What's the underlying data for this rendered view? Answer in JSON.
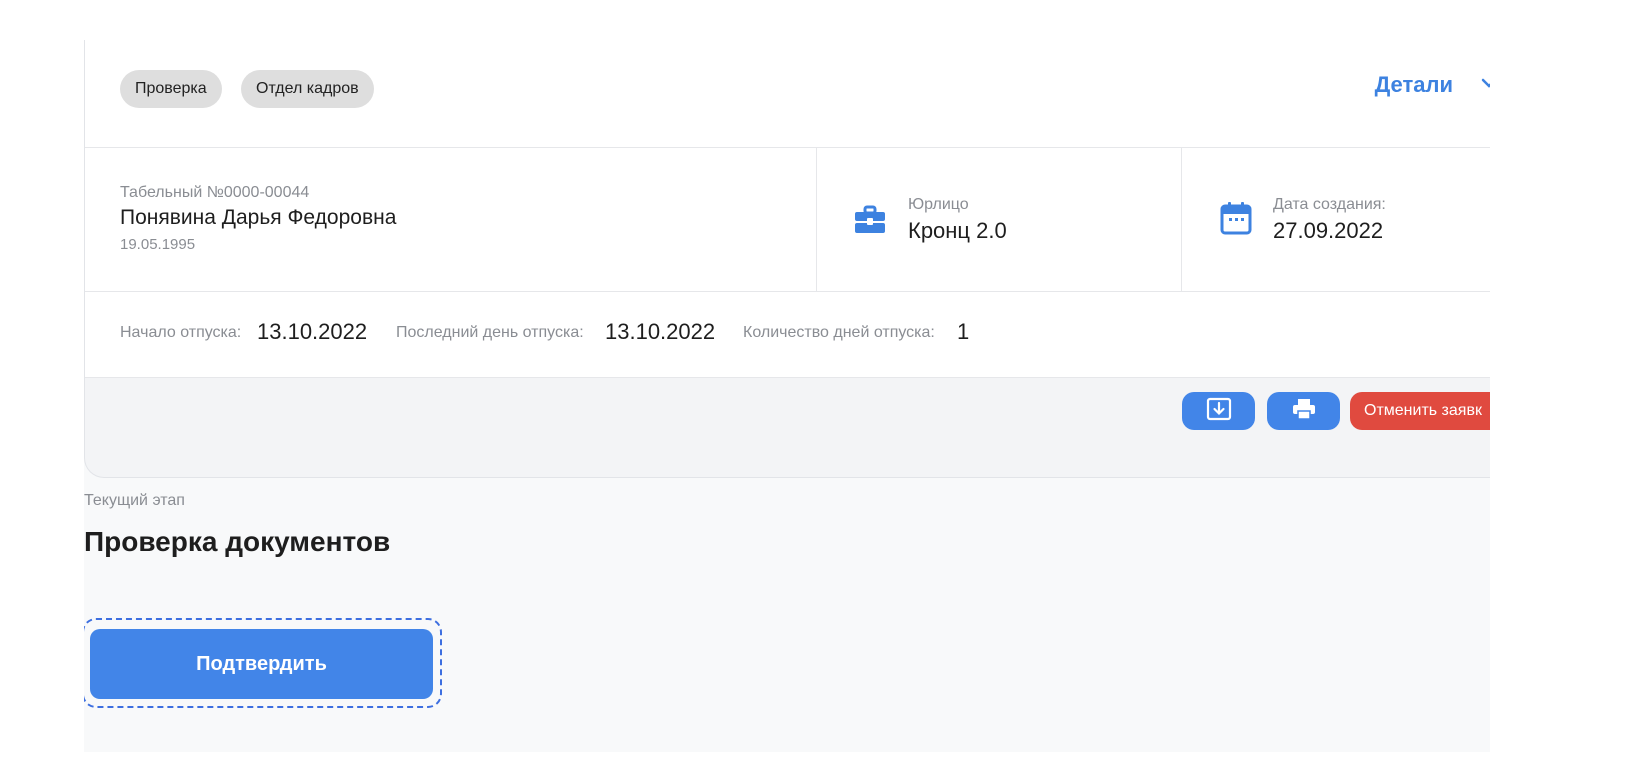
{
  "tags": [
    "Проверка",
    "Отдел кадров"
  ],
  "details": {
    "label": "Детали",
    "icon": "chevron-down-icon"
  },
  "employee": {
    "tab_number": "Табельный №0000-00044",
    "name": "Понявина Дарья Федоровна",
    "birth_date": "19.05.1995"
  },
  "legal_entity": {
    "label": "Юрлицо",
    "value": "Кронц 2.0",
    "icon": "briefcase-icon"
  },
  "created": {
    "label": "Дата создания:",
    "value": "27.09.2022",
    "icon": "calendar-icon"
  },
  "vacation": {
    "start_label": "Начало отпуска:",
    "start_value": "13.10.2022",
    "last_label": "Последний день отпуска:",
    "last_value": "13.10.2022",
    "days_label": "Количество дней отпуска:",
    "days_value": "1"
  },
  "actions": {
    "download_icon": "download-icon",
    "print_icon": "printer-icon",
    "cancel_label": "Отменить заявк"
  },
  "stage": {
    "label": "Текущий этап",
    "title": "Проверка документов"
  },
  "confirm_label": "Подтвердить",
  "colors": {
    "accent": "#4285e8",
    "link": "#3d82e0",
    "danger": "#e04a3f"
  }
}
